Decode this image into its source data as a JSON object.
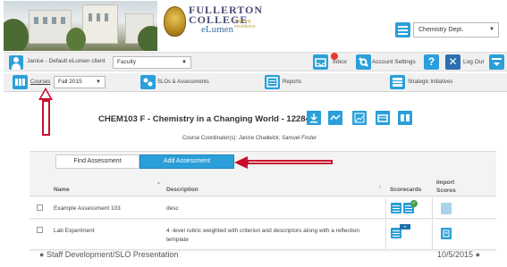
{
  "header": {
    "logo_line1": "FULLERTON",
    "logo_line2": "COLLEGE",
    "logo_line3": "eLumen",
    "logo_tagline": "inspiring excellence",
    "department_select": "Chemistry Dept."
  },
  "userbar": {
    "user_text": "Janice - Default eLumen client",
    "role_select": "Faculty",
    "inbox_label": "Inbox",
    "account_settings_label": "Account Settings",
    "help_glyph": "?",
    "logout_label": "Log Out"
  },
  "navbar": {
    "courses_label": "Courses",
    "term_select": "Fall 2015",
    "slos_label": "SLOs & Assessments",
    "reports_label": "Reports",
    "strategic_label": "Strategic Initiatives"
  },
  "course": {
    "title": "CHEM103 F - Chemistry in a Changing World - 12284",
    "coordinator_prefix": "Course Coordinator(s):",
    "coordinators": "Janice Chadwick, Samuel Foster"
  },
  "tabs": {
    "find": "Find Assessment",
    "add": "Add Assessment"
  },
  "table": {
    "headers": {
      "name": "Name",
      "description": "Description",
      "scorecards": "Scorecards",
      "import_line1": "Import",
      "import_line2": "Scores"
    },
    "rows": [
      {
        "name": "Example Assessment 103",
        "description": "desc"
      },
      {
        "name": "Lab Experiment",
        "description": "4 -level rubric weighted with criterion and descriptors along with a reflection",
        "description_line2": "template"
      }
    ]
  },
  "footer": {
    "left": "Staff Development/SLO Presentation",
    "right": "10/5/2015"
  },
  "colors": {
    "accent": "#2b9fd9",
    "annotation_red": "#c8102e",
    "check_green": "#43a047"
  },
  "icons": {
    "user": "user-icon",
    "inbox": "inbox-icon",
    "settings": "gear-icon",
    "help": "help-icon",
    "logout": "close-icon",
    "menu": "menu-icon"
  }
}
